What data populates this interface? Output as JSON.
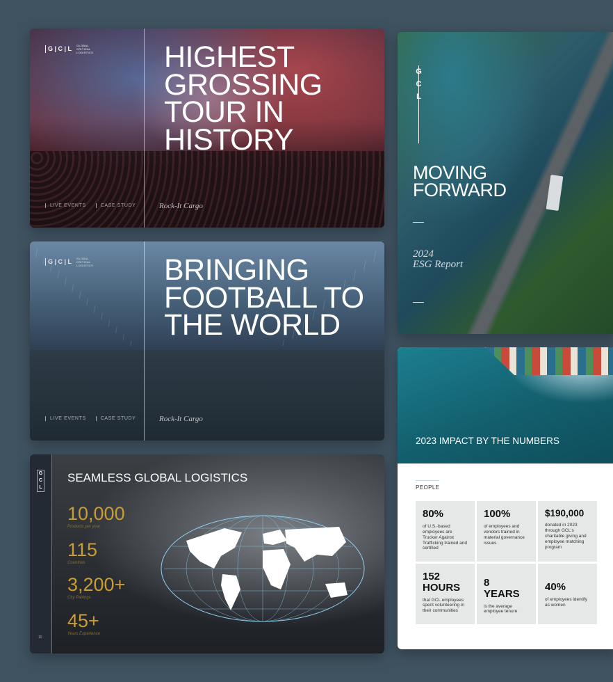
{
  "logo": {
    "mark": "G | C | L",
    "letters": [
      "G",
      "C",
      "L"
    ],
    "text": "GLOBAL CRITICAL LOGISTICS"
  },
  "card1": {
    "title_lines": [
      "HIGHEST",
      "GROSSING",
      "TOUR IN",
      "HISTORY"
    ],
    "tags": [
      "LIVE EVENTS",
      "CASE STUDY"
    ],
    "script": "Rock-It Cargo"
  },
  "card2": {
    "title_lines": [
      "BRINGING",
      "FOOTBALL TO",
      "THE WORLD"
    ],
    "tags": [
      "LIVE EVENTS",
      "CASE STUDY"
    ],
    "script": "Rock-It Cargo"
  },
  "card3": {
    "title": "SEAMLESS GLOBAL LOGISTICS",
    "page_num": "10",
    "stats": [
      {
        "value": "10,000",
        "label": "Products per year"
      },
      {
        "value": "115",
        "label": "Countries"
      },
      {
        "value": "3,200+",
        "label": "City Pairings"
      },
      {
        "value": "45+",
        "label": "Years Experience"
      }
    ]
  },
  "card4": {
    "title_lines": [
      "MOVING",
      "FORWARD"
    ],
    "year": "2024",
    "subtitle": "ESG Report"
  },
  "card5": {
    "hero_title": "2023 IMPACT BY THE NUMBERS",
    "section": "PEOPLE",
    "cells": [
      {
        "big": "80%",
        "desc": "of U.S.-based employees are Trucker Against Trafficking trained and certified"
      },
      {
        "big": "100%",
        "desc": "of employees and vendors trained in material governance issues"
      },
      {
        "big": "$190,000",
        "desc": "donated in 2023 through GCL's charitable giving and employee matching program"
      },
      {
        "big": "152 HOURS",
        "desc": "that GCL employees spent volunteering in their communities"
      },
      {
        "big": "8 YEARS",
        "desc": "is the average employee tenure"
      },
      {
        "big": "40%",
        "desc": "of employees identify as women"
      }
    ]
  }
}
